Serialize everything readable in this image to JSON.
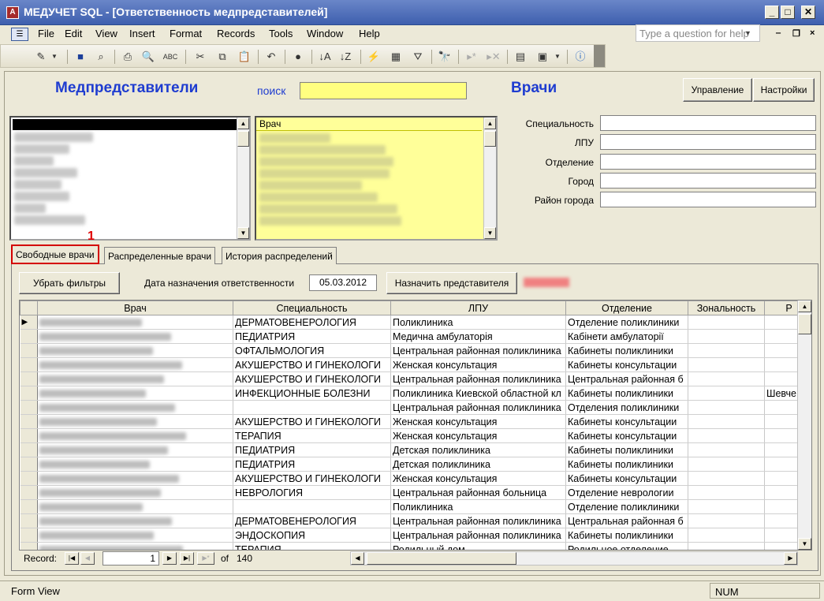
{
  "window": {
    "title": "МЕДУЧЕТ SQL - [Ответственность медпредставителей]",
    "app_icon": "А"
  },
  "menu": [
    "File",
    "Edit",
    "View",
    "Insert",
    "Format",
    "Records",
    "Tools",
    "Window",
    "Help"
  ],
  "help_placeholder": "Type a question for help",
  "form": {
    "medreps_heading": "Медпредставители",
    "search_label": "поиск",
    "doctors_heading": "Врачи",
    "btn_manage": "Управление",
    "btn_settings": "Настройки",
    "doctor_list_header": "Врач",
    "fields": [
      {
        "label": "Специальность"
      },
      {
        "label": "ЛПУ"
      },
      {
        "label": "Отделение"
      },
      {
        "label": "Город"
      },
      {
        "label": "Район города"
      }
    ]
  },
  "annotation_number": "1",
  "tabs": [
    "Свободные врачи",
    "Распределенные врачи",
    "История распределений"
  ],
  "filters": {
    "clear_btn": "Убрать фильтры",
    "date_label": "Дата назначения ответственности",
    "date_value": "05.03.2012",
    "assign_btn": "Назначить представителя"
  },
  "grid": {
    "columns": [
      "Врач",
      "Специальность",
      "ЛПУ",
      "Отделение",
      "Зональность",
      "Р"
    ],
    "rows": [
      [
        "",
        "ДЕРМАТОВЕНЕРОЛОГИЯ",
        "Поликлиника",
        "Отделение поликлиники",
        "",
        ""
      ],
      [
        "",
        "ПЕДИАТРИЯ",
        "Медична амбулаторія",
        "Кабінети амбулаторії",
        "",
        ""
      ],
      [
        "",
        "ОФТАЛЬМОЛОГИЯ",
        "Центральная районная поликлиника",
        "Кабинеты поликлиники",
        "",
        ""
      ],
      [
        "",
        "АКУШЕРСТВО И ГИНЕКОЛОГИ",
        "Женская консультация",
        "Кабинеты консультации",
        "",
        ""
      ],
      [
        "",
        "АКУШЕРСТВО И ГИНЕКОЛОГИ",
        "Центральная районная поликлиника",
        "Центральная районная б",
        "",
        ""
      ],
      [
        "",
        "ИНФЕКЦИОННЫЕ БОЛЕЗНИ",
        "Поликлиника Киевской областной кл",
        "Кабинеты поликлиники",
        "",
        "Шевче"
      ],
      [
        "",
        "",
        "Центральная районная поликлиника",
        "Отделения поликлиники",
        "",
        ""
      ],
      [
        "",
        "АКУШЕРСТВО И ГИНЕКОЛОГИ",
        "Женская консультация",
        "Кабинеты консультации",
        "",
        ""
      ],
      [
        "",
        "ТЕРАПИЯ",
        "Женская консультация",
        "Кабинеты консультации",
        "",
        ""
      ],
      [
        "",
        "ПЕДИАТРИЯ",
        "Детская поликлиника",
        "Кабинеты поликлиники",
        "",
        ""
      ],
      [
        "",
        "ПЕДИАТРИЯ",
        "Детская поликлиника",
        "Кабинеты поликлиники",
        "",
        ""
      ],
      [
        "",
        "АКУШЕРСТВО И ГИНЕКОЛОГИ",
        "Женская консультация",
        "Кабинеты консультации",
        "",
        ""
      ],
      [
        "",
        "НЕВРОЛОГИЯ",
        "Центральная районная больница",
        "Отделение неврологии",
        "",
        ""
      ],
      [
        "",
        "",
        "Поликлиника",
        "Отделение поликлиники",
        "",
        ""
      ],
      [
        "",
        "ДЕРМАТОВЕНЕРОЛОГИЯ",
        "Центральная районная поликлиника",
        "Центральная районная б",
        "",
        ""
      ],
      [
        "",
        "ЭНДОСКОПИЯ",
        "Центральная районная поликлиника",
        "Кабинеты поликлиники",
        "",
        ""
      ],
      [
        "",
        "ТЕРАПИЯ",
        "Родильный дом",
        "Родильное отделение",
        "",
        ""
      ]
    ]
  },
  "nav": {
    "label": "Record:",
    "current": "1",
    "of": "of",
    "total": "140"
  },
  "status": {
    "left": "Form View",
    "right": "NUM"
  }
}
